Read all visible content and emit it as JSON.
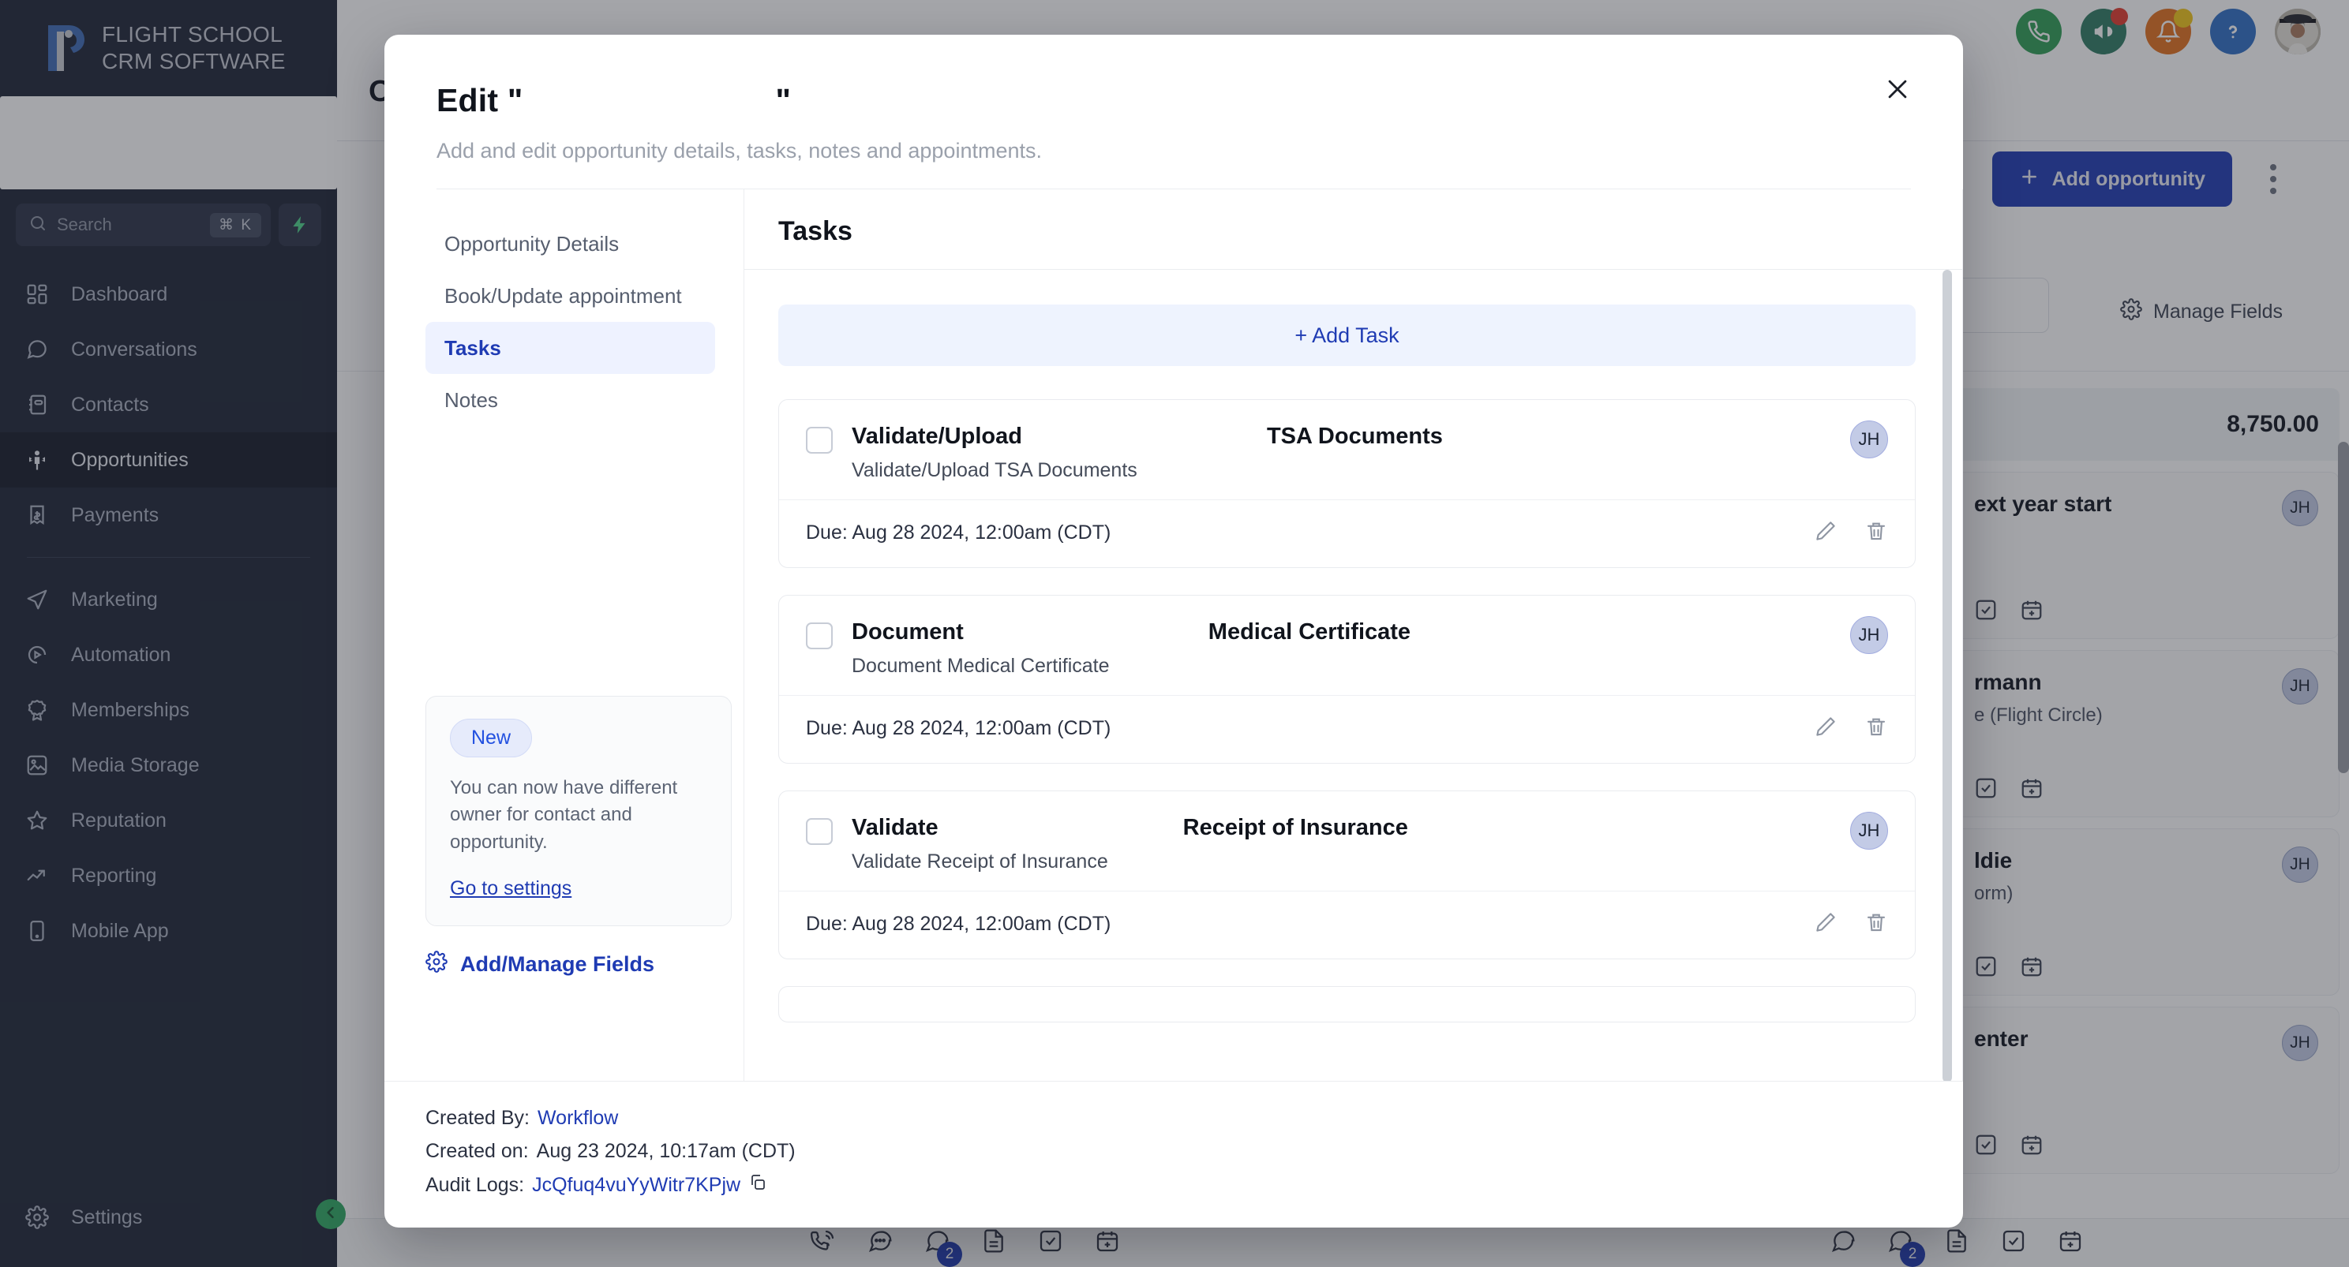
{
  "sidebar": {
    "brand": {
      "line1": "FLIGHT SCHOOL",
      "line2": "CRM SOFTWARE",
      "logo_icon": "flight-school-r-logo"
    },
    "search": {
      "placeholder": "Search",
      "shortcut": "⌘ K",
      "icon": "search-icon",
      "spark_icon": "lightning-bolt-icon"
    },
    "items": [
      {
        "label": "Dashboard",
        "icon": "dashboard-grid-icon"
      },
      {
        "label": "Conversations",
        "icon": "chat-bubble-icon"
      },
      {
        "label": "Contacts",
        "icon": "address-book-icon"
      },
      {
        "label": "Opportunities",
        "icon": "opportunities-icon"
      },
      {
        "label": "Payments",
        "icon": "payments-receipt-icon"
      }
    ],
    "items2": [
      {
        "label": "Marketing",
        "icon": "paper-plane-icon"
      },
      {
        "label": "Automation",
        "icon": "play-circle-icon"
      },
      {
        "label": "Memberships",
        "icon": "award-ribbon-icon"
      },
      {
        "label": "Media Storage",
        "icon": "image-icon"
      },
      {
        "label": "Reputation",
        "icon": "star-icon"
      },
      {
        "label": "Reporting",
        "icon": "trending-up-icon"
      },
      {
        "label": "Mobile App",
        "icon": "mobile-phone-icon"
      }
    ],
    "settings": {
      "label": "Settings",
      "icon": "gear-icon"
    },
    "collapse_icon": "chevron-left-icon"
  },
  "topbar": {
    "icons": [
      {
        "name": "phone-icon",
        "color": "#2f9e55"
      },
      {
        "name": "megaphone-icon",
        "color": "#2f7a63"
      },
      {
        "name": "bell-icon",
        "color": "#e2701e"
      },
      {
        "name": "help-question-icon",
        "color": "#2f6fc4"
      }
    ],
    "avatar": "user-avatar-photo"
  },
  "page": {
    "title": "O",
    "add_opportunity_label": "Add opportunity",
    "add_icon": "plus-icon",
    "kebab_icon": "more-vertical-icon",
    "manage_fields_label": "Manage Fields",
    "manage_fields_icon": "gear-icon",
    "column_total": "8,750.00",
    "cards": [
      {
        "name": "ext year start",
        "sub": "",
        "avatar": "JH"
      },
      {
        "name": "rmann",
        "sub": "e (Flight Circle)",
        "avatar": "JH"
      },
      {
        "name": "ldie",
        "sub": "orm)",
        "avatar": "JH"
      },
      {
        "name": "enter",
        "sub": "",
        "avatar": "JH"
      }
    ],
    "card_icons": [
      "check-square-icon",
      "calendar-plus-icon"
    ],
    "bottombar_icons_left": [
      "phone-outgoing-icon",
      "chat-dots-icon",
      "messages-icon",
      "document-icon",
      "check-square-icon",
      "calendar-plus-icon"
    ],
    "bottombar_icons_right": [
      "chat-dots-icon",
      "messages-icon",
      "document-icon",
      "check-square-icon",
      "calendar-plus-icon"
    ],
    "message_badge": "2"
  },
  "modal": {
    "title_prefix": "Edit \"",
    "title_suffix": "\"",
    "subtitle": "Add and edit opportunity details, tasks, notes and appointments.",
    "close_icon": "close-icon",
    "nav": [
      {
        "label": "Opportunity Details"
      },
      {
        "label": "Book/Update appointment"
      },
      {
        "label": "Tasks"
      },
      {
        "label": "Notes"
      }
    ],
    "promo": {
      "badge": "New",
      "text": "You can now have different owner for contact and opportunity.",
      "link": "Go to settings"
    },
    "manage_fields_link": "Add/Manage Fields",
    "manage_fields_icon": "gear-icon",
    "main": {
      "heading": "Tasks",
      "add_task_label": "+ Add Task",
      "tasks": [
        {
          "title_prefix": "Validate/Upload",
          "title_suffix": "TSA Documents",
          "description": "Validate/Upload TSA Documents",
          "due": "Due: Aug 28 2024, 12:00am (CDT)",
          "avatar": "JH",
          "edit_icon": "pencil-icon",
          "delete_icon": "trash-icon"
        },
        {
          "title_prefix": "Document",
          "title_suffix": "Medical Certificate",
          "description": "Document Medical Certificate",
          "due": "Due: Aug 28 2024, 12:00am (CDT)",
          "avatar": "JH",
          "edit_icon": "pencil-icon",
          "delete_icon": "trash-icon"
        },
        {
          "title_prefix": "Validate",
          "title_suffix": "Receipt of Insurance",
          "description": "Validate Receipt of Insurance",
          "due": "Due: Aug 28 2024, 12:00am (CDT)",
          "avatar": "JH",
          "edit_icon": "pencil-icon",
          "delete_icon": "trash-icon"
        }
      ]
    },
    "footer": {
      "created_by_label": "Created By:",
      "created_by_value": "Workflow",
      "created_on_label": "Created on:",
      "created_on_value": "Aug 23 2024, 10:17am (CDT)",
      "audit_label": "Audit Logs:",
      "audit_value": "JcQfuq4vuYyWitr7KPjw",
      "copy_icon": "copy-icon"
    }
  },
  "colors": {
    "accent": "#1f3bb3",
    "sidebar_bg": "#1e2536",
    "active_nav": "#151b29"
  }
}
